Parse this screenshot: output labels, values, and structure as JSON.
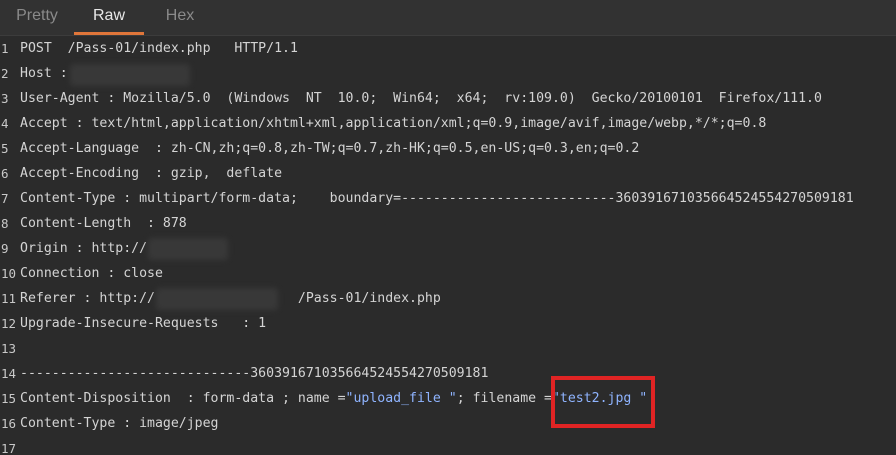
{
  "tabs": [
    {
      "label": "Pretty",
      "active": false
    },
    {
      "label": "Raw",
      "active": true
    },
    {
      "label": "Hex",
      "active": false
    }
  ],
  "colors": {
    "accent": "#e0763a",
    "highlight_box": "#e02424",
    "string": "#8fb4ff"
  },
  "lines": [
    {
      "num": "1",
      "text": "POST  /Pass-01/index.php   HTTP/1.1"
    },
    {
      "num": "2",
      "text": "Host : "
    },
    {
      "num": "3",
      "text": "User-Agent : Mozilla/5.0  (Windows  NT  10.0;  Win64;  x64;  rv:109.0)  Gecko/20100101  Firefox/111.0"
    },
    {
      "num": "4",
      "text": "Accept : text/html,application/xhtml+xml,application/xml;q=0.9,image/avif,image/webp,*/*;q=0.8"
    },
    {
      "num": "5",
      "text": "Accept-Language  : zh-CN,zh;q=0.8,zh-TW;q=0.7,zh-HK;q=0.5,en-US;q=0.3,en;q=0.2"
    },
    {
      "num": "6",
      "text": "Accept-Encoding  : gzip,  deflate"
    },
    {
      "num": "7",
      "text": "Content-Type : multipart/form-data;    boundary=---------------------------360391671035664524554270509181"
    },
    {
      "num": "8",
      "text": "Content-Length  : 878"
    },
    {
      "num": "9",
      "text": "Origin : http://"
    },
    {
      "num": "10",
      "text": "Connection : close"
    },
    {
      "num": "11",
      "text": "Referer : http://                  /Pass-01/index.php"
    },
    {
      "num": "12",
      "text": "Upgrade-Insecure-Requests   : 1"
    },
    {
      "num": "13",
      "text": ""
    },
    {
      "num": "14",
      "text": "-----------------------------360391671035664524554270509181"
    },
    {
      "num": "15",
      "pre": "Content-Disposition  : form-data ; name =",
      "name_val": "\"upload_file \"",
      "mid": "; filename =",
      "file_val": "\"test2.jpg \""
    },
    {
      "num": "16",
      "text": "Content-Type : image/jpeg"
    },
    {
      "num": "17",
      "text": ""
    }
  ]
}
